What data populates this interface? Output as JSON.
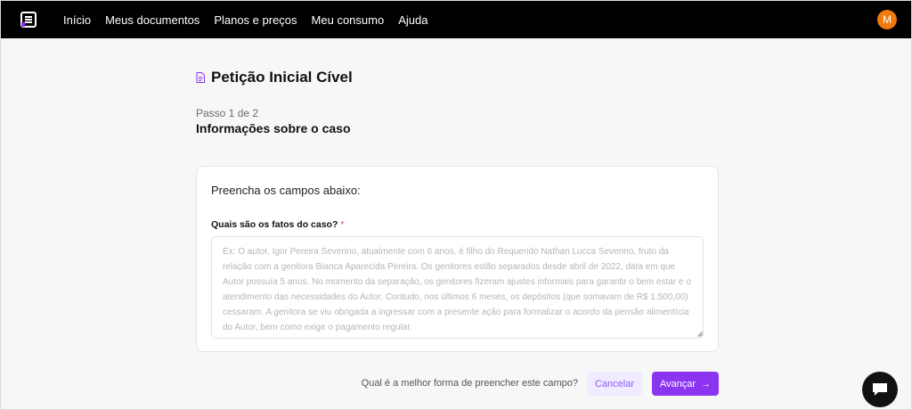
{
  "nav": {
    "links": [
      "Início",
      "Meus documentos",
      "Planos e preços",
      "Meu consumo",
      "Ajuda"
    ],
    "avatar_initial": "M"
  },
  "page": {
    "title": "Petição Inicial Cível",
    "step": "Passo 1 de 2",
    "section_title": "Informações sobre o caso"
  },
  "form": {
    "intro": "Preencha os campos abaixo:",
    "field_label": "Quais são os fatos do caso?",
    "required_mark": "*",
    "value": "",
    "placeholder": "Ex: O autor, Igor Pereira Severino, atualmente com 6 anos, é filho do Requerido Nathan Lucca Severino, fruto da relação com a genitora Bianca Aparecida Pereira. Os genitores estão separados desde abril de 2022, data em que Autor possuía 5 anos. No momento da separação, os genitores fizeram ajustes informais para garantir o bem estar e o atendimento das necessidades do Autor. Contudo, nos últimos 6 meses, os depósitos (que somavam de R$ 1.500,00) cessaram. A genitora se viu obrigada a ingressar com a presente ação para formalizar o acordo da pensão alimentícia do Autor, bem como exigir o pagamento regular."
  },
  "footer": {
    "help_text": "Qual é a melhor forma de preencher este campo?",
    "cancel_label": "Cancelar",
    "advance_label": "Avançar",
    "advance_arrow": "→"
  },
  "colors": {
    "accent": "#8b35f0",
    "cancel_bg": "#f1ebff",
    "avatar": "#f07a10",
    "navbar": "#000000"
  },
  "icons": [
    "logo-icon",
    "document-icon",
    "arrow-right-icon",
    "chat-icon",
    "resize-handle-icon"
  ]
}
